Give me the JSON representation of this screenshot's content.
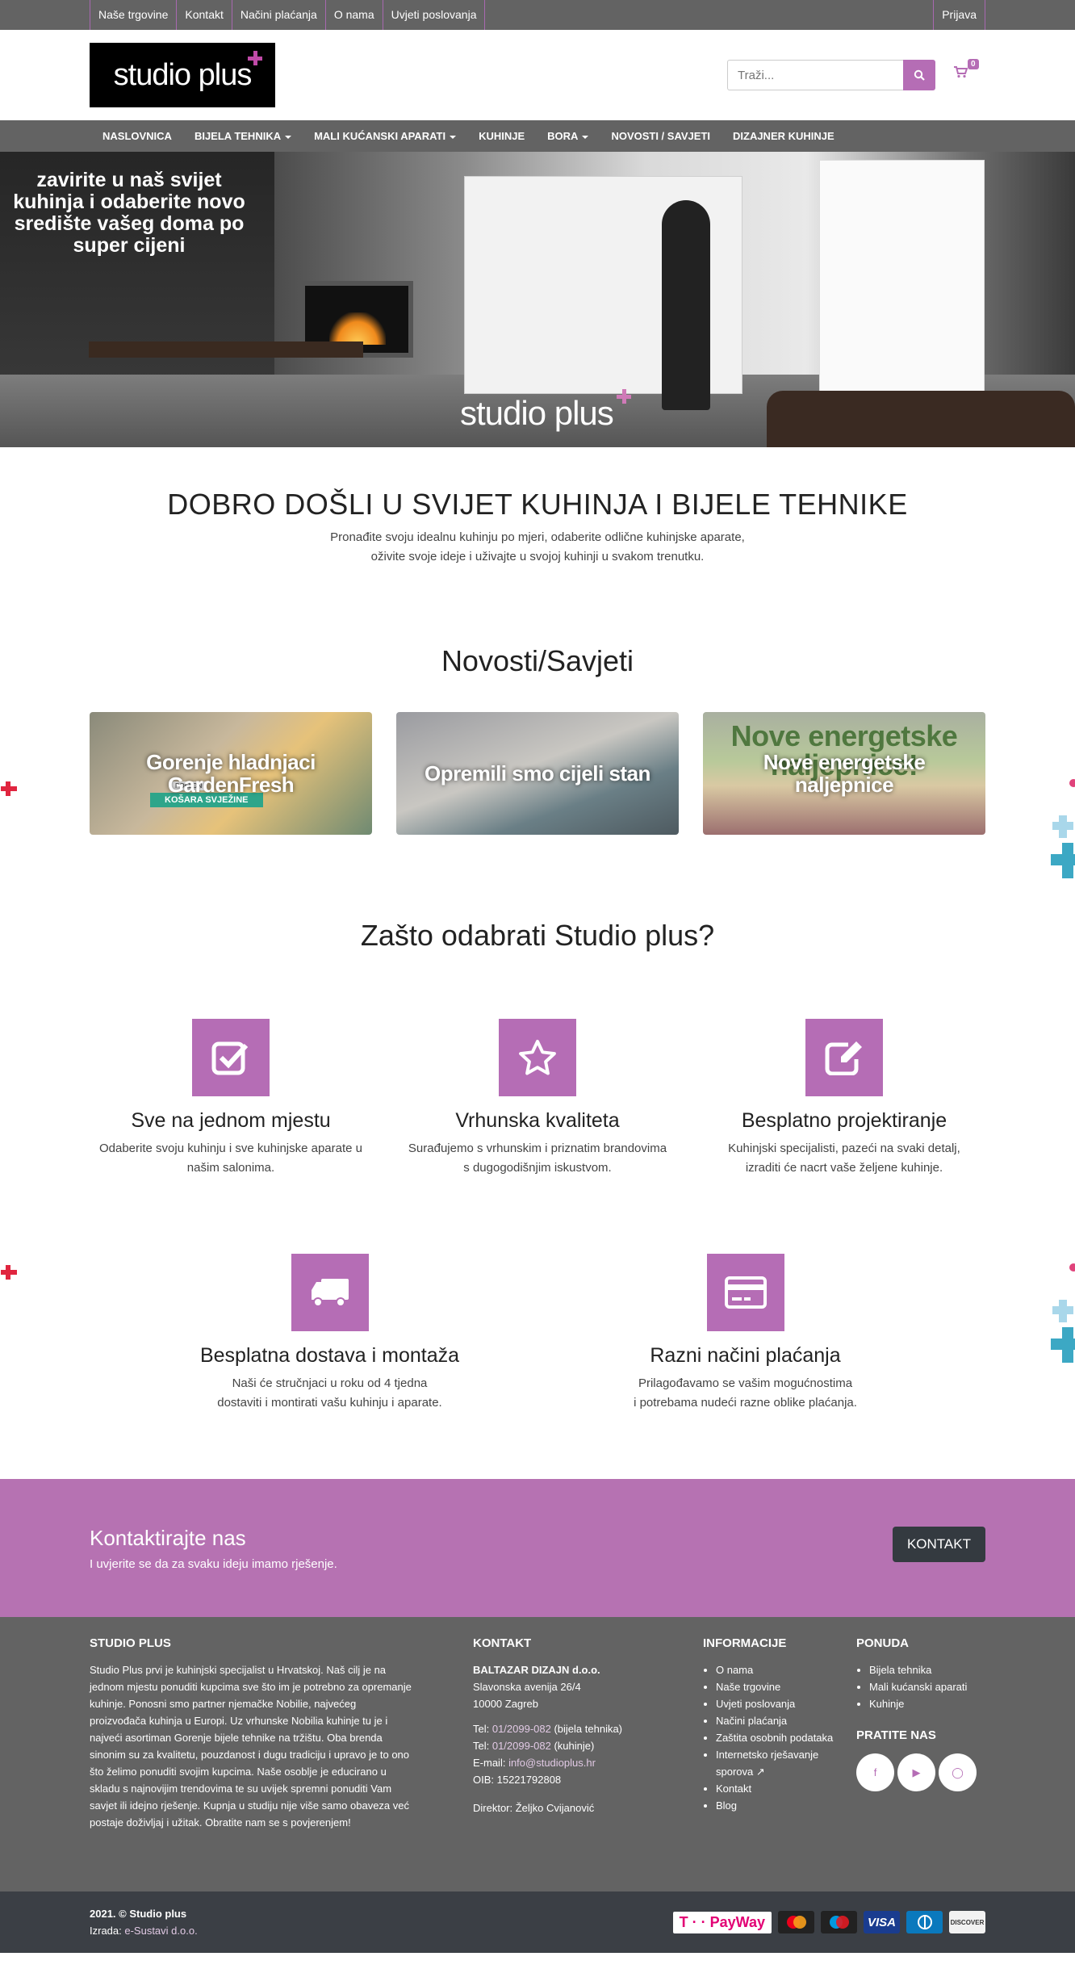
{
  "topbar": {
    "links": [
      "Naše trgovine",
      "Kontakt",
      "Načini plaćanja",
      "O nama",
      "Uvjeti poslovanja"
    ],
    "login": "Prijava"
  },
  "header": {
    "logo_text": "studio plus",
    "search_placeholder": "Traži...",
    "cart_count": "0"
  },
  "nav": {
    "items": [
      "NASLOVNICA",
      "BIJELA TEHNIKA",
      "MALI KUĆANSKI APARATI",
      "KUHINJE",
      "BORA",
      "NOVOSTI / SAVJETI",
      "DIZAJNER KUHINJE"
    ]
  },
  "hero": {
    "text": "zavirite u naš svijet kuhinja i  odaberite novo središte vašeg doma po super cijeni",
    "logo": "studio plus"
  },
  "welcome": {
    "title": "DOBRO DOŠLI U SVIJET KUHINJA I BIJELE TEHNIKE",
    "line1": "Pronađite svoju idealnu kuhinju po mjeri, odaberite odlične kuhinjske aparate,",
    "line2": "oživite svoje ideje i uživajte u svojoj kuhinji u svakom trenutku."
  },
  "news": {
    "title": "Novosti/Savjeti",
    "cards": [
      {
        "title": "Gorenje hladnjaci GardenFresh",
        "badge": "KOŠARA SVJEŽINE",
        "tag": "POKLON"
      },
      {
        "title": "Opremili smo cijeli stan"
      },
      {
        "title": "Nove energetske naljepnice",
        "bg_text": "Nove energetske naljepnice!"
      }
    ]
  },
  "why": {
    "title": "Zašto odabrati Studio plus?",
    "features": [
      {
        "icon": "check-square-icon",
        "title": "Sve na jednom mjestu",
        "l1": "Odaberite svoju kuhinju i sve kuhinjske aparate u",
        "l2": "našim salonima."
      },
      {
        "icon": "star-icon",
        "title": "Vrhunska kvaliteta",
        "l1": "Surađujemo s vrhunskim i priznatim brandovima",
        "l2": "s dugogodišnjim iskustvom."
      },
      {
        "icon": "edit-icon",
        "title": "Besplatno projektiranje",
        "l1": "Kuhinjski specijalisti, pazeći na svaki detalj,",
        "l2": "izraditi će nacrt vaše željene kuhinje."
      },
      {
        "icon": "truck-icon",
        "title": "Besplatna dostava i montaža",
        "l1": "Naši će stručnjaci u roku od 4 tjedna",
        "l2": "dostaviti i montirati vašu kuhinju i aparate."
      },
      {
        "icon": "credit-card-icon",
        "title": "Razni načini plaćanja",
        "l1": "Prilagođavamo se vašim mogućnostima",
        "l2": "i potrebama nudeći razne oblike plaćanja."
      }
    ]
  },
  "contact_band": {
    "title": "Kontaktirajte nas",
    "text": "I uvjerite se da za svaku ideju imamo rješenje.",
    "button": "KONTAKT"
  },
  "footer": {
    "about_title": "STUDIO PLUS",
    "about_text": "Studio Plus prvi je kuhinjski specijalist u Hrvatskoj. Naš cilj je na jednom mjestu ponuditi kupcima sve što im je potrebno za opremanje kuhinje. Ponosni smo partner njemačke Nobilie, najvećeg proizvođača kuhinja u Europi. Uz vrhunske Nobilia kuhinje tu je i najveći asortiman Gorenje bijele tehnike na tržištu. Oba brenda sinonim su za kvalitetu, pouzdanost i dugu tradiciju i upravo je to ono što želimo ponuditi svojim kupcima. Naše osoblje je educirano u skladu s najnovijim trendovima te su uvijek spremni ponuditi Vam savjet ili idejno rješenje. Kupnja u studiju nije više samo obaveza već postaje doživljaj i užitak. Obratite nam se s povjerenjem!",
    "contact_title": "KONTAKT",
    "company": "BALTAZAR DIZAJN d.o.o.",
    "street": "Slavonska avenija 26/4",
    "city": "10000 Zagreb",
    "tel1_label": "Tel: ",
    "tel1": "01/2099-082",
    "tel1_note": " (bijela tehnika)",
    "tel2_label": "Tel: ",
    "tel2": "01/2099-082",
    "tel2_note": " (kuhinje)",
    "email_label": "E-mail: ",
    "email": "info@studioplus.hr",
    "oib": "OIB: 15221792808",
    "director": "Direktor: Željko Cvijanović",
    "info_title": "INFORMACIJE",
    "info_links": [
      "O nama",
      "Naše trgovine",
      "Uvjeti poslovanja",
      "Načini plaćanja",
      "Zaštita osobnih podataka",
      "Internetsko rješavanje sporova",
      "Kontakt",
      "Blog"
    ],
    "offer_title": "PONUDA",
    "offer_links": [
      "Bijela tehnika",
      "Mali kućanski aparati",
      "Kuhinje"
    ],
    "follow_title": "PRATITE NAS"
  },
  "bottom": {
    "copyright": "2021. © Studio plus",
    "made_by_label": "Izrada: ",
    "made_by": "e-Sustavi d.o.o.",
    "payway": "T · · PayWay",
    "cards": [
      "mastercard",
      "maestro",
      "VISA",
      "diners",
      "DISCOVER"
    ]
  },
  "colors": {
    "accent": "#b56db5",
    "bar": "#636363",
    "dark": "#343a40"
  }
}
